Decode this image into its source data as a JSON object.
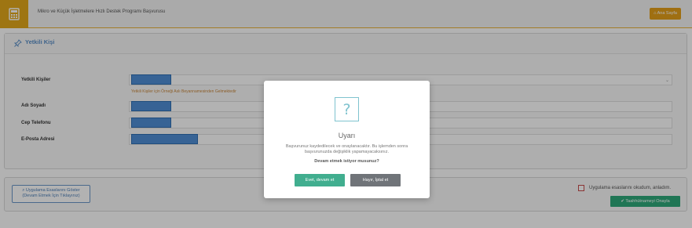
{
  "header": {
    "title": "Mikro ve Küçük İşletmelere Hızlı Destek Programı Başvurusu",
    "icon": "calculator-icon",
    "home_label": "Ana Sayfa",
    "home_icon": "home-icon",
    "accent": "#e3a81a"
  },
  "panel": {
    "title": "Yetkili Kişi",
    "icon": "pin-icon",
    "fields": {
      "authorized_label": "Yetkili Kişiler",
      "authorized_warning": "Yetkili Kişiler için Örneği Aslı Beyannamesinden Gelmektedir",
      "name_label": "Adı Soyadı",
      "phone_label": "Cep Telefonu",
      "email_label": "E-Posta Adresi"
    }
  },
  "bottom": {
    "rules_line1": "Uygulama Esaslarını Göster",
    "rules_line2": "(Devam Etmek İçin Tıklayınız)",
    "rules_icon": "search-icon",
    "checkbox_label": "Uygulama esaslarını okudum, anladım.",
    "confirm_label": "Taahhütnameyi Onayla",
    "confirm_icon": "check-icon"
  },
  "modal": {
    "icon": "question-icon",
    "title": "Uyarı",
    "body": "Başvurunuz kaydedilecek ve onaylanacaktır. Bu işlemden sonra başvurunuzda değişiklik yapamayacaksınız.",
    "question": "Devam etmek istiyor musunuz?",
    "yes_label": "Evet, devam et",
    "no_label": "Hayır, İptal et"
  }
}
